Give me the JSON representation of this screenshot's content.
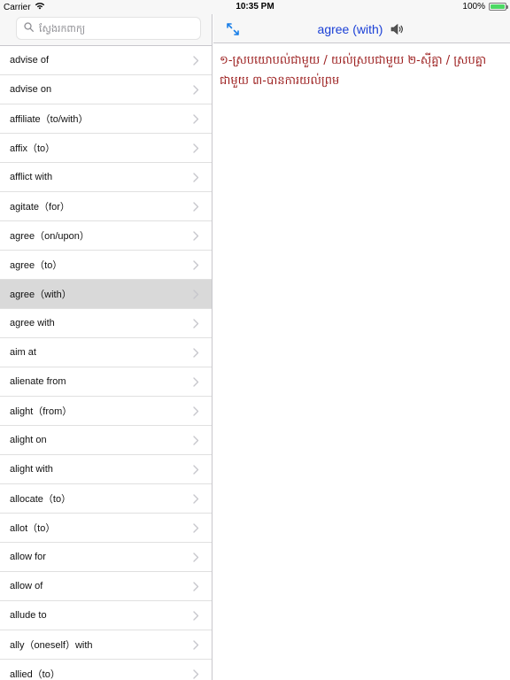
{
  "status_bar": {
    "carrier": "Carrier",
    "time": "10:35 PM",
    "battery": "100%",
    "battery_level": 1.0
  },
  "sidebar": {
    "search_placeholder": "ស្វែងរកពាក្យ",
    "items": [
      {
        "label": "advise of"
      },
      {
        "label": "advise on"
      },
      {
        "label": "affiliate（to/with）"
      },
      {
        "label": "affix（to）"
      },
      {
        "label": "afflict with"
      },
      {
        "label": "agitate（for）"
      },
      {
        "label": "agree（on/upon）"
      },
      {
        "label": "agree（to）"
      },
      {
        "label": "agree（with）",
        "selected": true
      },
      {
        "label": "agree with"
      },
      {
        "label": "aim at"
      },
      {
        "label": "alienate from"
      },
      {
        "label": "alight（from）"
      },
      {
        "label": "alight on"
      },
      {
        "label": "alight with"
      },
      {
        "label": "allocate（to）"
      },
      {
        "label": "allot（to）"
      },
      {
        "label": "allow for"
      },
      {
        "label": "allow of"
      },
      {
        "label": "allude to"
      },
      {
        "label": "ally（oneself）with"
      },
      {
        "label": "allied（to）"
      }
    ]
  },
  "detail": {
    "title": "agree (with)",
    "definition": "១-ស្របយោបល់ជាមួយ / យល់ស្របជាមួយ ២-ស៊ីគ្នា / ស្របគ្នាជាមួយ ៣-បានការយល់ព្រម"
  },
  "colors": {
    "accent": "#1a3fd6",
    "definition_text": "#9b1c1c",
    "selected_row": "#d9d9d9"
  },
  "icons": {
    "wifi": "wifi-icon",
    "search": "search-icon",
    "chevron": "chevron-right-icon",
    "expand": "expand-icon",
    "speaker": "speaker-icon"
  }
}
